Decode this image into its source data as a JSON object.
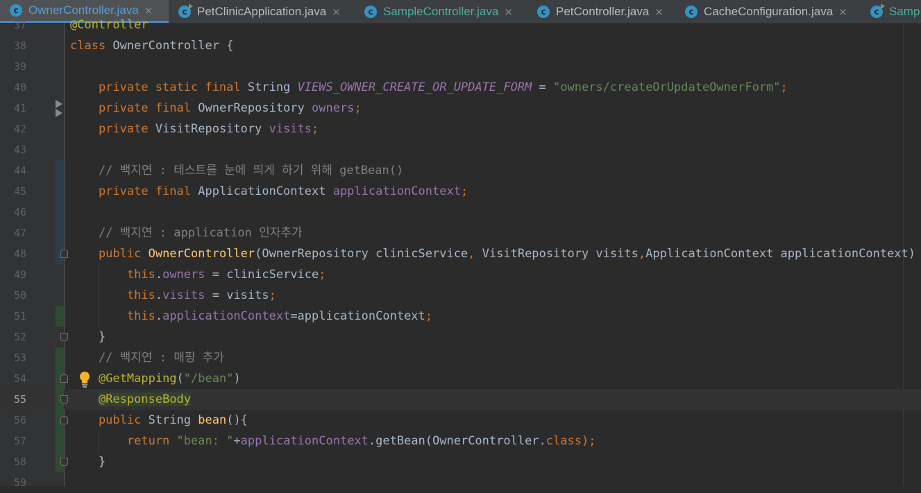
{
  "tabs": [
    {
      "label": "OwnerController.java",
      "active": true,
      "color": "#5f9bd1",
      "closable": true
    },
    {
      "label": "PetClinicApplication.java",
      "active": false,
      "color": "#bbbbbb",
      "closable": true,
      "run_marker": true
    },
    {
      "label": "SampleController.java",
      "active": false,
      "color": "#4cae9c",
      "closable": true
    },
    {
      "label": "PetController.java",
      "active": false,
      "color": "#bbbbbb",
      "closable": true
    },
    {
      "label": "CacheConfiguration.java",
      "active": false,
      "color": "#bbbbbb",
      "closable": true
    },
    {
      "label": "Samp",
      "active": false,
      "color": "#4cae9c",
      "closable": false,
      "run_marker": true
    }
  ],
  "editor": {
    "current_line": "55",
    "lines": [
      {
        "n": "37",
        "parts": [
          {
            "t": "@Controller",
            "c": "ann"
          }
        ]
      },
      {
        "n": "38",
        "parts": [
          {
            "t": "class ",
            "c": "kw"
          },
          {
            "t": "OwnerController {",
            "c": ""
          }
        ]
      },
      {
        "n": "39",
        "parts": []
      },
      {
        "n": "40",
        "parts": [
          {
            "t": "    private static final ",
            "c": "kw"
          },
          {
            "t": "String ",
            "c": ""
          },
          {
            "t": "VIEWS_OWNER_CREATE_OR_UPDATE_FORM",
            "c": "cst"
          },
          {
            "t": " = ",
            "c": ""
          },
          {
            "t": "\"owners/createOrUpdateOwnerForm\"",
            "c": "str"
          },
          {
            "t": ";",
            "c": "kw"
          }
        ]
      },
      {
        "n": "41",
        "parts": [
          {
            "t": "    private final ",
            "c": "kw"
          },
          {
            "t": "OwnerRepository ",
            "c": ""
          },
          {
            "t": "owners",
            "c": "fld"
          },
          {
            "t": ";",
            "c": "kw"
          }
        ]
      },
      {
        "n": "42",
        "parts": [
          {
            "t": "    private ",
            "c": "kw"
          },
          {
            "t": "VisitRepository ",
            "c": ""
          },
          {
            "t": "visits",
            "c": "fld"
          },
          {
            "t": ";",
            "c": "kw"
          }
        ]
      },
      {
        "n": "43",
        "parts": []
      },
      {
        "n": "44",
        "parts": [
          {
            "t": "    // 백지연 : 테스트를 눈에 띄게 하기 위해 getBean()",
            "c": "cmt"
          }
        ]
      },
      {
        "n": "45",
        "parts": [
          {
            "t": "    private final ",
            "c": "kw"
          },
          {
            "t": "ApplicationContext ",
            "c": ""
          },
          {
            "t": "applicationContext",
            "c": "fld"
          },
          {
            "t": ";",
            "c": "kw"
          }
        ]
      },
      {
        "n": "46",
        "parts": []
      },
      {
        "n": "47",
        "parts": [
          {
            "t": "    // 백지연 : application 인자추가",
            "c": "cmt"
          }
        ]
      },
      {
        "n": "48",
        "parts": [
          {
            "t": "    public ",
            "c": "kw"
          },
          {
            "t": "OwnerController",
            "c": "fn"
          },
          {
            "t": "(OwnerRepository clinicService",
            "c": ""
          },
          {
            "t": ", ",
            "c": "kw"
          },
          {
            "t": "VisitRepository visits",
            "c": ""
          },
          {
            "t": ",",
            "c": "kw"
          },
          {
            "t": "ApplicationContext applicationContext) {",
            "c": ""
          }
        ]
      },
      {
        "n": "49",
        "parts": [
          {
            "t": "        this",
            "c": "kw"
          },
          {
            "t": ".",
            "c": ""
          },
          {
            "t": "owners",
            "c": "fld"
          },
          {
            "t": " = clinicService",
            "c": ""
          },
          {
            "t": ";",
            "c": "kw"
          }
        ]
      },
      {
        "n": "50",
        "parts": [
          {
            "t": "        this",
            "c": "kw"
          },
          {
            "t": ".",
            "c": ""
          },
          {
            "t": "visits",
            "c": "fld"
          },
          {
            "t": " = visits",
            "c": ""
          },
          {
            "t": ";",
            "c": "kw"
          }
        ]
      },
      {
        "n": "51",
        "parts": [
          {
            "t": "        this",
            "c": "kw"
          },
          {
            "t": ".",
            "c": ""
          },
          {
            "t": "applicationContext",
            "c": "fld"
          },
          {
            "t": "=applicationContext",
            "c": ""
          },
          {
            "t": ";",
            "c": "kw"
          }
        ]
      },
      {
        "n": "52",
        "parts": [
          {
            "t": "    }",
            "c": ""
          }
        ]
      },
      {
        "n": "53",
        "parts": [
          {
            "t": "    // 백지연 : 매핑 추가",
            "c": "cmt"
          }
        ]
      },
      {
        "n": "54",
        "parts": [
          {
            "t": "    ",
            "c": ""
          },
          {
            "t": "@GetMapping",
            "c": "ann"
          },
          {
            "t": "(",
            "c": ""
          },
          {
            "t": "\"/bean\"",
            "c": "str"
          },
          {
            "t": ")",
            "c": ""
          }
        ]
      },
      {
        "n": "55",
        "parts": [
          {
            "t": "    ",
            "c": ""
          },
          {
            "t": "@ResponseBody",
            "c": "ann hl"
          }
        ]
      },
      {
        "n": "56",
        "parts": [
          {
            "t": "    public ",
            "c": "kw"
          },
          {
            "t": "String ",
            "c": ""
          },
          {
            "t": "bean",
            "c": "fn"
          },
          {
            "t": "(){",
            "c": ""
          }
        ]
      },
      {
        "n": "57",
        "parts": [
          {
            "t": "        return ",
            "c": "kw"
          },
          {
            "t": "\"bean: \"",
            "c": "str"
          },
          {
            "t": "+",
            "c": ""
          },
          {
            "t": "applicationContext",
            "c": "fld"
          },
          {
            "t": ".getBean(OwnerController.",
            "c": ""
          },
          {
            "t": "class",
            "c": "kw"
          },
          {
            "t": ");",
            "c": "kw"
          }
        ]
      },
      {
        "n": "58",
        "parts": [
          {
            "t": "    }",
            "c": ""
          }
        ]
      },
      {
        "n": "59",
        "parts": []
      }
    ]
  }
}
